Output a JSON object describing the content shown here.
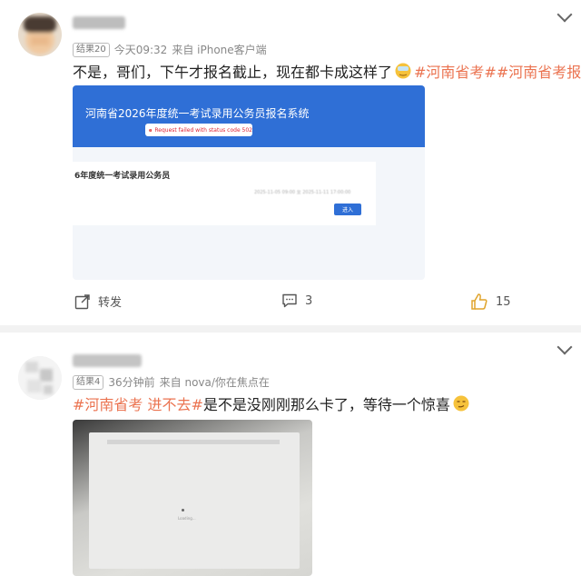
{
  "post1": {
    "badge": "结果20",
    "time": "今天09:32",
    "source": "来自 iPhone客户端",
    "text_main": "不是，哥们，下午才报名截止，现在都卡成这样了",
    "tags": [
      "#河南省考#",
      "#河南省考报名#"
    ],
    "image": {
      "header_title": "河南省2026年度统一考试录用公务员报名系统",
      "alert_text": "Request failed with status code 502",
      "card_title": "6年度统一考试录用公务员",
      "card_date": "2025-11-05 09:00 至 2025-11-11 17:00:00",
      "enter_label": "进入"
    },
    "actions": {
      "repost_label": "转发",
      "comment_count": "3",
      "like_count": "15"
    }
  },
  "post2": {
    "badge": "结果4",
    "time": "36分钟前",
    "source": "来自 nova/你在焦点在",
    "tag": "#河南省考 进不去#",
    "text_main": "是不是没刚刚那么卡了，等待一个惊喜",
    "image": {
      "loading_text": "Loading..."
    }
  },
  "colors": {
    "tag": "#eb7350",
    "banner_blue": "#2f6fd6",
    "like": "#e0a42c"
  }
}
